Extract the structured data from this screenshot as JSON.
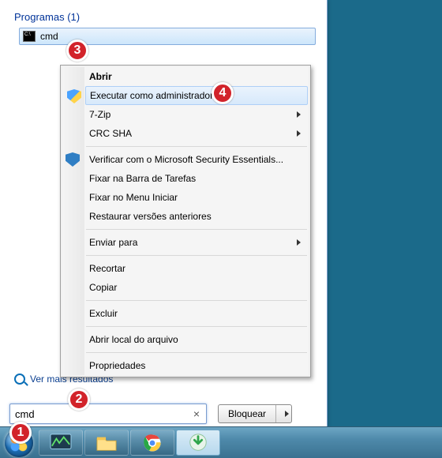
{
  "start": {
    "section_header": "Programas (1)",
    "result_label": "cmd",
    "more_results": "Ver mais resultados",
    "search_value": "cmd",
    "lock_label": "Bloquear"
  },
  "context_menu": {
    "items": [
      {
        "label": "Abrir",
        "bold": true
      },
      {
        "label": "Executar como administrador",
        "icon": "shield",
        "highlight": true
      },
      {
        "label": "7-Zip",
        "submenu": true
      },
      {
        "label": "CRC SHA",
        "submenu": true
      },
      {
        "sep": true
      },
      {
        "label": "Verificar com o Microsoft Security Essentials...",
        "icon": "shield-blue"
      },
      {
        "label": "Fixar na Barra de Tarefas"
      },
      {
        "label": "Fixar no Menu Iniciar"
      },
      {
        "label": "Restaurar versões anteriores"
      },
      {
        "sep": true
      },
      {
        "label": "Enviar para",
        "submenu": true
      },
      {
        "sep": true
      },
      {
        "label": "Recortar"
      },
      {
        "label": "Copiar"
      },
      {
        "sep": true
      },
      {
        "label": "Excluir"
      },
      {
        "sep": true
      },
      {
        "label": "Abrir local do arquivo"
      },
      {
        "sep": true
      },
      {
        "label": "Propriedades"
      }
    ]
  },
  "taskbar": {
    "buttons": [
      "task-manager",
      "file-explorer",
      "chrome",
      "downloader"
    ]
  },
  "badges": {
    "b1": "1",
    "b2": "2",
    "b3": "3",
    "b4": "4"
  }
}
